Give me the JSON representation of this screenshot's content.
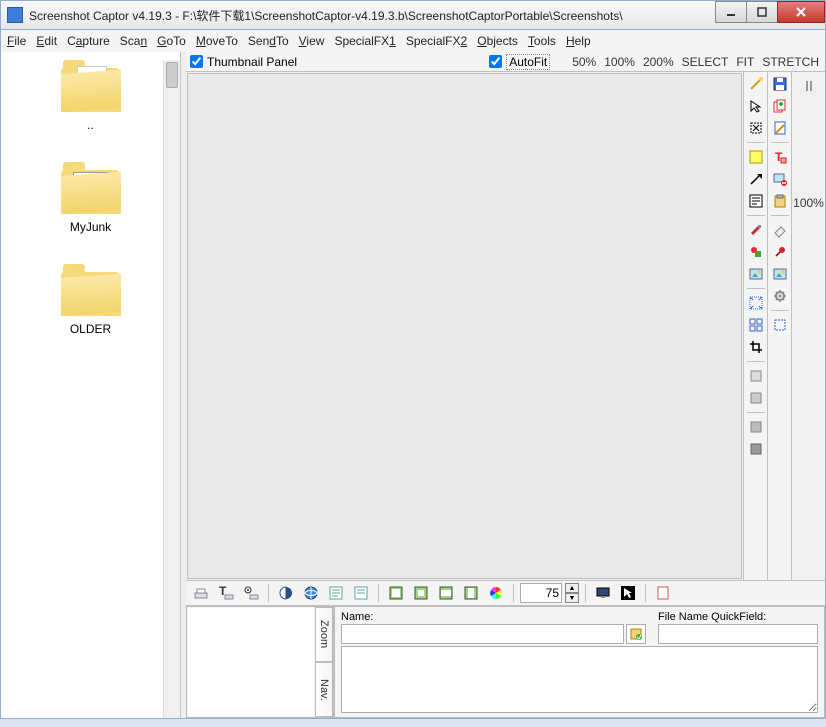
{
  "window": {
    "title": "Screenshot Captor v4.19.3 - F:\\软件下载1\\ScreenshotCaptor-v4.19.3.b\\ScreenshotCaptorPortable\\Screenshots\\"
  },
  "menu": {
    "file": "File",
    "edit": "Edit",
    "capture": "Capture",
    "scan": "Scan",
    "goto": "GoTo",
    "moveto": "MoveTo",
    "sendto": "SendTo",
    "view": "View",
    "sfx1": "SpecialFX1",
    "sfx2": "SpecialFX2",
    "objects": "Objects",
    "tools": "Tools",
    "help": "Help"
  },
  "folders": [
    {
      "label": "..",
      "kind": "up"
    },
    {
      "label": "MyJunk",
      "kind": "thumb"
    },
    {
      "label": "OLDER",
      "kind": "plain"
    }
  ],
  "thumbbar": {
    "panel_label": "Thumbnail Panel",
    "autofit_label": "AutoFit",
    "z50": "50%",
    "z100": "100%",
    "z200": "200%",
    "select": "SELECT",
    "fit": "FIT",
    "stretch": "STRETCH"
  },
  "right_strip": {
    "pct": "100%"
  },
  "bottom": {
    "spin_value": "75"
  },
  "fields": {
    "name_label": "Name:",
    "qf_label": "File Name QuickField:"
  },
  "tabs": {
    "zoom": "Zoom",
    "nav": "Nav."
  }
}
